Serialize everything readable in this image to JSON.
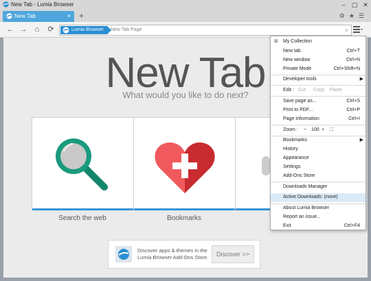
{
  "window": {
    "title": "New Tab - Lumia Browser"
  },
  "tab": {
    "label": "New Tab",
    "close": "×",
    "new_tab": "+"
  },
  "tab_tools": {
    "settings": "⚙",
    "star": "★",
    "list": "☰"
  },
  "nav": {
    "back": "←",
    "forward": "→",
    "home": "⌂",
    "reload": "⟳"
  },
  "omnibox": {
    "brand": "Lumia Browser",
    "placeholder": "New Tab Page",
    "clear": "×"
  },
  "page": {
    "title": "New Tab",
    "subtitle": "What would you like to do next?",
    "tiles": [
      {
        "label": "Search the web",
        "icon": "magnifier-icon"
      },
      {
        "label": "Bookmarks",
        "icon": "heart-plus-icon"
      }
    ],
    "discover_text": "Discover apps & themes in the Lumia Browser Add-Ons Store.",
    "discover_button": "Discover >>"
  },
  "menu": {
    "items": {
      "my_collection": "My Collection",
      "new_tab": {
        "label": "New tab",
        "shortcut": "Ctrl+T"
      },
      "new_window": {
        "label": "New window",
        "shortcut": "Ctrl+N"
      },
      "private_mode": {
        "label": "Private Mode",
        "shortcut": "Ctrl+Shift+N"
      },
      "developer_tools": "Developer tools",
      "edit": {
        "label": "Edit :",
        "cut": "Cut",
        "copy": "Copy",
        "paste": "Paste"
      },
      "save_page": {
        "label": "Save page as...",
        "shortcut": "Ctrl+S"
      },
      "print_pdf": {
        "label": "Print to PDF...",
        "shortcut": "Ctrl+P"
      },
      "page_info": {
        "label": "Page information",
        "shortcut": "Ctrl+I"
      },
      "zoom": {
        "label": "Zoom :",
        "minus": "−",
        "value": "100",
        "plus": "+",
        "fullscreen": "⛶"
      },
      "bookmarks": "Bookmarks",
      "history": "History",
      "appearance": "Appearance",
      "settings": "Settings",
      "addons_store": "Add-Ons Store",
      "downloads_manager": "Downloads Manager",
      "active_downloads": "Active Downloads: (none)",
      "about": "About Lumia Browser",
      "report": "Report an issue...",
      "exit": {
        "label": "Exit",
        "shortcut": "Ctrl+F4"
      }
    }
  },
  "colors": {
    "accent": "#3a94d8",
    "tab": "#4ea6dc",
    "magnifier": "#1a9a7e",
    "heart": "#e03a3e"
  }
}
